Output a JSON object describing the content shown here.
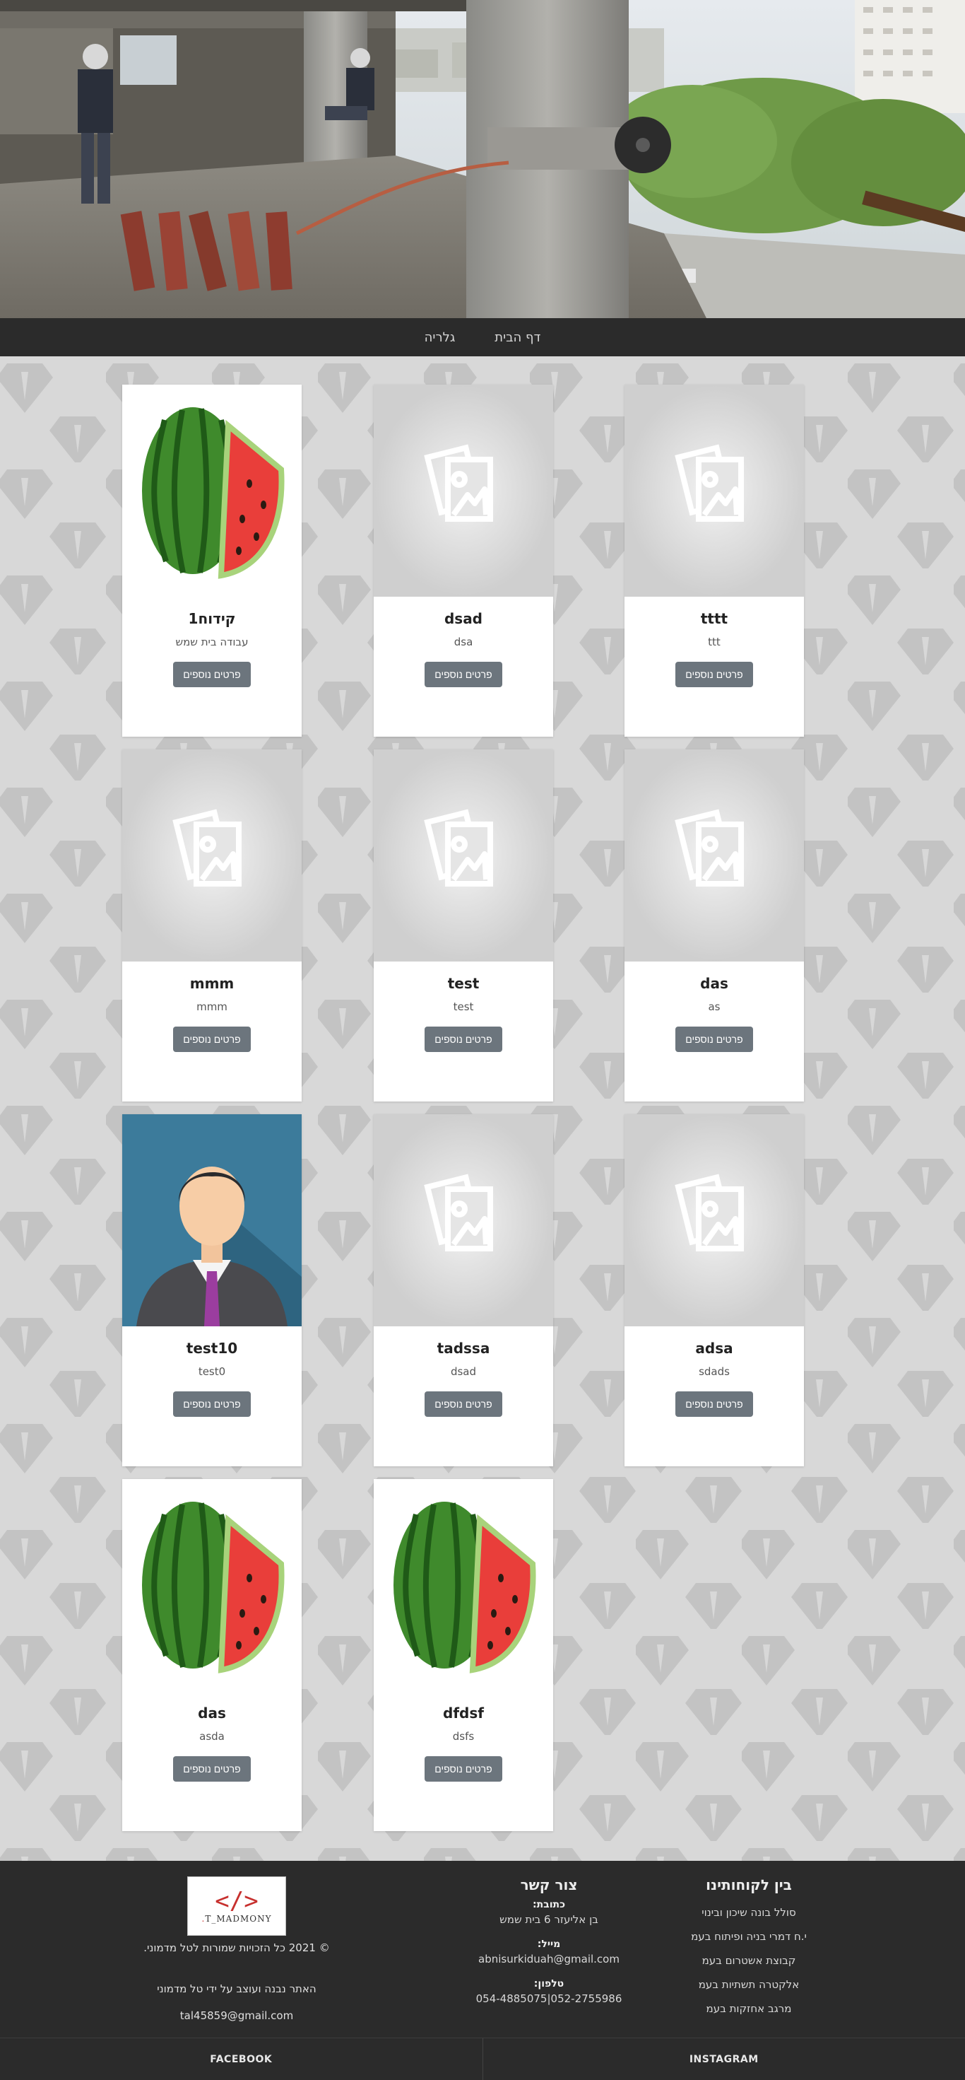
{
  "hero": {
    "image": "construction-site-photo"
  },
  "nav": {
    "items": [
      {
        "label": "דף הבית"
      },
      {
        "label": "גלריה"
      }
    ]
  },
  "gallery": {
    "button_label": "פרטים נוספים",
    "cards": [
      {
        "title": "tttt",
        "desc": "ttt",
        "image": "placeholder"
      },
      {
        "title": "dsad",
        "desc": "dsa",
        "image": "placeholder"
      },
      {
        "title": "קידוח1",
        "desc": "עבודה בית שמש",
        "image": "watermelon"
      },
      {
        "title": "das",
        "desc": "as",
        "image": "placeholder"
      },
      {
        "title": "test",
        "desc": "test",
        "image": "placeholder"
      },
      {
        "title": "mmm",
        "desc": "mmm",
        "image": "placeholder"
      },
      {
        "title": "adsa",
        "desc": "sdads",
        "image": "placeholder"
      },
      {
        "title": "tadssa",
        "desc": "dsad",
        "image": "placeholder"
      },
      {
        "title": "test10",
        "desc": "test0",
        "image": "avatar"
      },
      {
        "title": "dfdsf",
        "desc": "dsfs",
        "image": "watermelon"
      },
      {
        "title": "das",
        "desc": "asda",
        "image": "watermelon"
      }
    ]
  },
  "footer": {
    "clients": {
      "heading": "בין לקוחותינו",
      "items": [
        "סולל בונה שיכון ובינוי",
        "י.ח דמרי בניה ופיתוח בעמ",
        "קבוצת אשטרום בעמ",
        "אלקטרה תשתיות בעמ",
        "מרגב אחזקות בעמ"
      ]
    },
    "contact": {
      "heading": "צור קשר",
      "address_label": "כתובת:",
      "address": "בן אליעזר 6 בית שמש",
      "email_label": "מייל:",
      "email": "abnisurkiduah@gmail.com",
      "phone_label": "טלפון:",
      "phone": "052-2755986|054-4885075"
    },
    "brand": {
      "logo_code": "</>",
      "logo_name": "T_MADMONY",
      "logo_dot": ".",
      "copyright": "© 2021  כל הזכויות שמורות לטל מדמוני.",
      "credit": "האתר נבנה ועוצב על ידי טל מדמוני",
      "email": "tal45859@gmail.com"
    }
  },
  "social": {
    "facebook": "FACEBOOK",
    "instagram": "INSTAGRAM"
  },
  "colors": {
    "dark_bg": "#2b2b2b",
    "button": "#6c757d",
    "page_bg": "#d7d7d7",
    "logo_accent": "#c7302e"
  }
}
